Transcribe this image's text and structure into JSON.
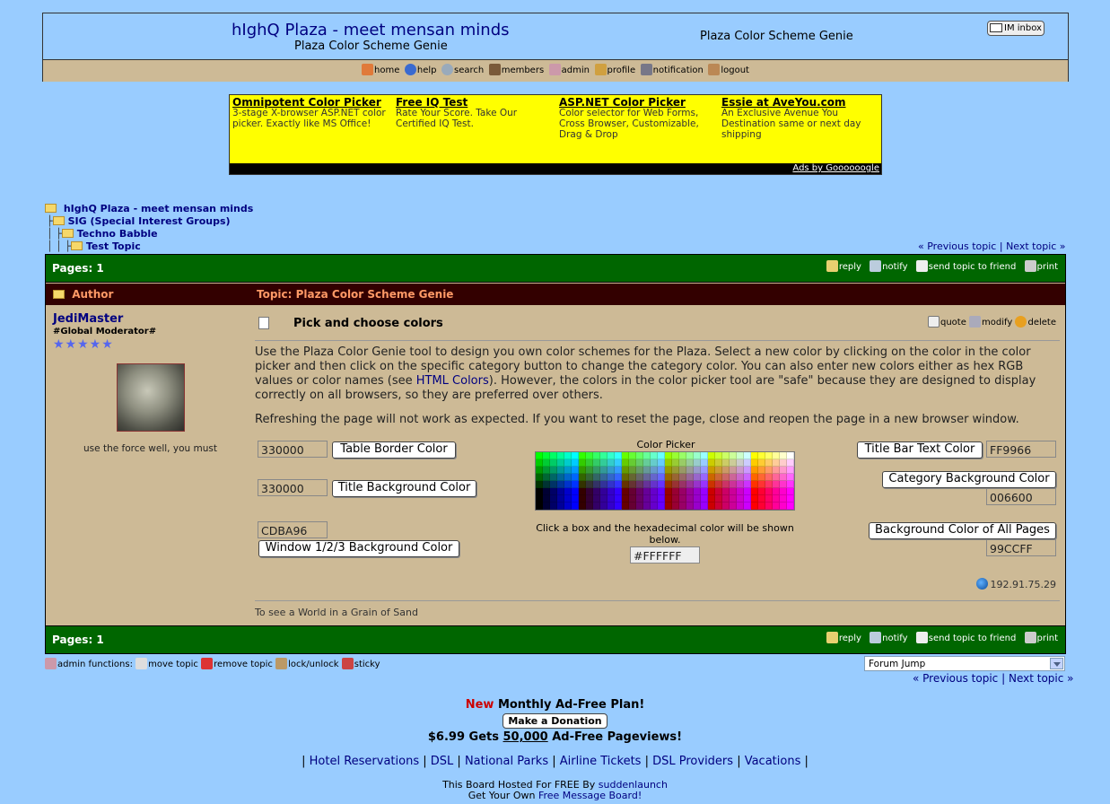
{
  "header": {
    "site_title": "hIghQ Plaza - meet mensan minds",
    "subtitle": "Plaza Color Scheme Genie",
    "subtitle_right": "Plaza Color Scheme Genie",
    "im_inbox": "IM inbox"
  },
  "nav": {
    "home": "home",
    "help": "help",
    "search": "search",
    "members": "members",
    "admin": "admin",
    "profile": "profile",
    "notification": "notification",
    "logout": "logout"
  },
  "ads": {
    "items": [
      {
        "title": "Omnipotent Color Picker",
        "text": "3-stage X-browser ASP.NET color picker. Exactly like MS Office!"
      },
      {
        "title": "Free IQ Test",
        "text": "Rate Your Score. Take Our Certified IQ Test."
      },
      {
        "title": "ASP.NET Color Picker",
        "text": "Color selector for Web Forms, Cross Browser, Customizable, Drag & Drop"
      },
      {
        "title": "Essie at AveYou.com",
        "text": "An Exclusive Avenue You Destination same or next day shipping"
      }
    ],
    "ads_by": "Ads by Goooooogle"
  },
  "breadcrumb": {
    "level0": "hIghQ Plaza - meet mensan minds",
    "level1": "SIG (Special Interest Groups)",
    "level2": "Techno Babble",
    "level3": "Test Topic"
  },
  "topic_nav": {
    "prev": "« Previous topic",
    "sep": "|",
    "next": "Next topic »"
  },
  "toolbar": {
    "pages": "Pages: 1",
    "reply": "reply",
    "notify": "notify",
    "send": "send topic to friend",
    "print": "print"
  },
  "table_header": {
    "author": "Author",
    "topic": "Topic: Plaza Color Scheme Genie"
  },
  "poster": {
    "name": "JediMaster",
    "rank": "#Global Moderator#",
    "stars": "★★★★★",
    "signature": "use the force well, you must"
  },
  "post": {
    "title": "Pick and choose colors",
    "quote": "quote",
    "modify": "modify",
    "delete": "delete",
    "para1_a": "Use the Plaza Color Genie tool to design you own color schemes for the Plaza. Select a new color by clicking on the color in the color picker and then click on the specific category button to change the category color. You can also enter new colors either as hex RGB values or color names (see ",
    "para1_link": "HTML Colors",
    "para1_b": "). However, the colors in the color picker tool are \"safe\" because they are designed to display correctly on all browsers, so they are preferred over others.",
    "para2": "Refreshing the page will not work as expected. If you want to reset the page, close and reopen the page in a new browser window.",
    "ip": "192.91.75.29",
    "signature": "To see a World in a Grain of Sand"
  },
  "genie": {
    "table_border_value": "330000",
    "table_border_label": "Table Border Color",
    "title_bg_value": "330000",
    "title_bg_label": "Title Background Color",
    "window_bg_value": "CDBA96",
    "window_bg_label": "Window 1/2/3 Background Color",
    "picker_label": "Color Picker",
    "picker_hint": "Click a box and the hexadecimal color will be shown below.",
    "picker_value": "#FFFFFF",
    "title_text_label": "Title Bar Text Color",
    "title_text_value": "FF9966",
    "category_bg_label": "Category Background Color",
    "category_bg_value": "006600",
    "page_bg_label": "Background Color of All Pages",
    "page_bg_value": "99CCFF"
  },
  "admin_functions": {
    "label": "admin functions:",
    "move": "move topic",
    "remove": "remove topic",
    "lock": "lock/unlock",
    "sticky": "sticky"
  },
  "forum_jump": "Forum Jump",
  "promo": {
    "new": "New",
    "plan": "Monthly Ad-Free Plan!",
    "donate": "Make a Donation",
    "price": "$6.99 Gets",
    "count": "50,000",
    "suffix": "Ad-Free Pageviews!"
  },
  "links": [
    "Hotel Reservations",
    "DSL",
    "National Parks",
    "Airline Tickets",
    "DSL Providers",
    "Vacations"
  ],
  "footer": {
    "line1": "This Board Hosted For FREE By",
    "host": "suddenlaunch",
    "line2": "Get Your Own",
    "free_board": "Free Message Board!"
  },
  "colors": {
    "page_bg": "#99CCFF",
    "window_bg": "#CDBA96",
    "category_bg": "#006600",
    "title_bg": "#330000",
    "title_text": "#FF9966",
    "ad_bg": "#FFFF00"
  }
}
